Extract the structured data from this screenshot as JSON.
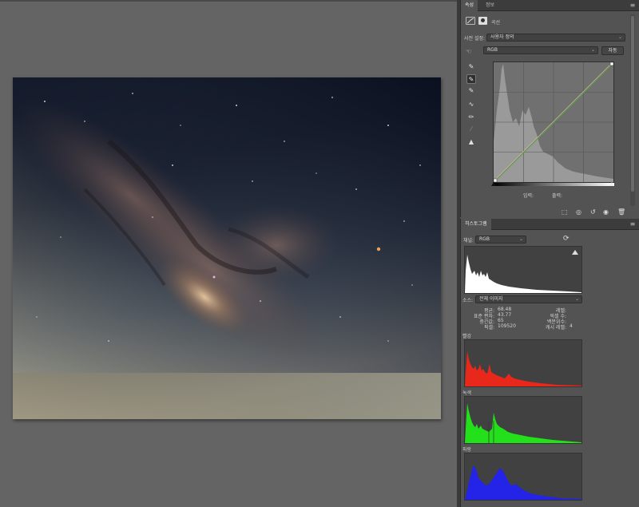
{
  "properties_panel": {
    "tabs": [
      "속성",
      "정보"
    ],
    "adjustment_name": "곡선",
    "preset_label": "사전 설정:",
    "preset_value": "사용자 정의",
    "channel_value": "RGB",
    "auto_label": "자동",
    "input_label": "입력:",
    "output_label": "출력:",
    "tools": [
      "eyedropper-black-icon",
      "eyedropper-gray-icon",
      "eyedropper-white-icon",
      "curve-point-icon",
      "pencil-icon",
      "smooth-icon",
      "clipping-warning-icon"
    ],
    "footer_icons": [
      "clip-to-layer-icon",
      "view-previous-icon",
      "reset-icon",
      "visibility-icon",
      "delete-icon"
    ]
  },
  "histogram_panel": {
    "title": "히스토그램",
    "channel_label": "채널:",
    "channel_value": "RGB",
    "source_label": "소스:",
    "source_value": "전체 이미지",
    "stats": {
      "mean_label": "평균:",
      "mean_value": "68.48",
      "stddev_label": "표준 편차:",
      "stddev_value": "43.77",
      "median_label": "중간값:",
      "median_value": "65",
      "pixels_label": "픽셀:",
      "pixels_value": "109520",
      "level_label": "레벨:",
      "level_value": "",
      "count_label": "픽셀 수:",
      "count_value": "",
      "percentile_label": "백분위수:",
      "percentile_value": "",
      "cache_label": "캐시 레벨:",
      "cache_value": "4"
    },
    "channels": [
      {
        "name": "빨강",
        "color": "#e8281a"
      },
      {
        "name": "녹색",
        "color": "#22e11a"
      },
      {
        "name": "파랑",
        "color": "#2424e8"
      }
    ]
  },
  "colors": {
    "panel_bg": "#535353",
    "canvas_bg": "#646464",
    "red": "#e8281a",
    "green": "#22e11a",
    "blue": "#2424e8"
  }
}
